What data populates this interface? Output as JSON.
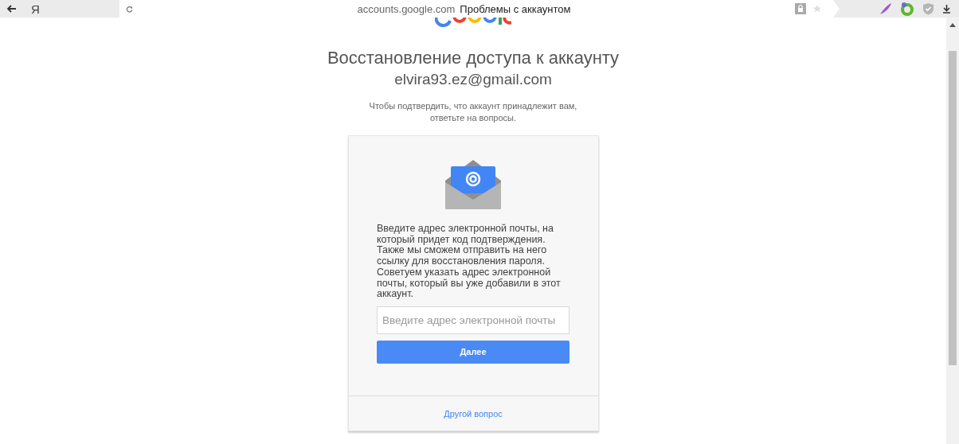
{
  "browser": {
    "logo": "Я",
    "url": "accounts.google.com",
    "page_title": "Проблемы с аккаунтом"
  },
  "page": {
    "title": "Восстановление доступа к аккаунту",
    "email": "elvira93.ez@gmail.com",
    "subtitle": "Чтобы подтвердить, что аккаунт принадлежит вам, ответьте на вопросы.",
    "card": {
      "instructions": "Введите адрес электронной почты, на который придет код подтверждения. Также мы сможем отправить на него ссылку для восстановления пароля. Советуем указать адрес электронной почты, который вы уже добавили в этот аккаунт.",
      "email_field": {
        "placeholder": "Введите адрес электронной почты"
      },
      "next_button": "Далее",
      "other_link": "Другой вопрос"
    }
  }
}
